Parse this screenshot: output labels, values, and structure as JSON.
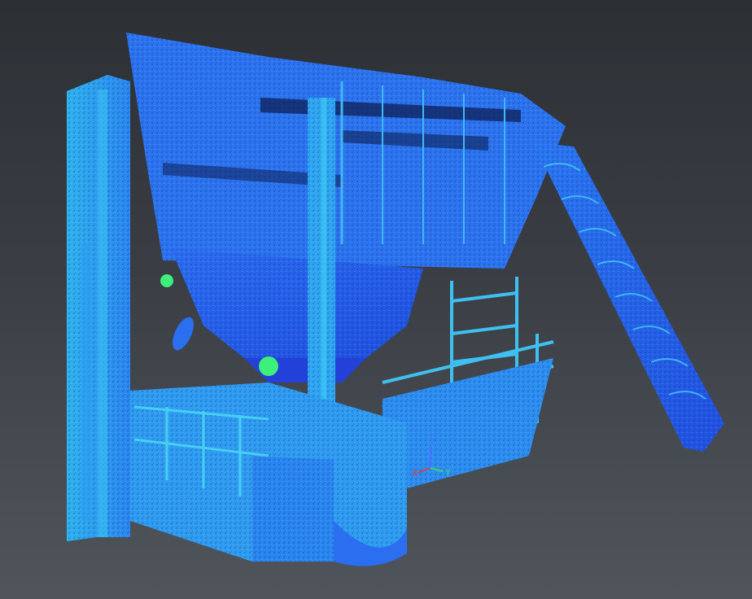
{
  "viewport": {
    "background_top": "#2c2f34",
    "background_bottom": "#50555c",
    "scalar_palette": [
      "#1f4fe0",
      "#2c6cf2",
      "#2a8cf5",
      "#2fb0f4",
      "#3fd3f2",
      "#3cf07a"
    ]
  },
  "model": {
    "name": "point-cloud-model",
    "render_mode": "scalar-colored-points"
  },
  "axes_gizmo": {
    "x_label": "X",
    "y_label": "Y",
    "z_label": "Z",
    "x_color": "#e23a3a",
    "y_color": "#3fd36a",
    "z_color": "#4a6cff"
  }
}
